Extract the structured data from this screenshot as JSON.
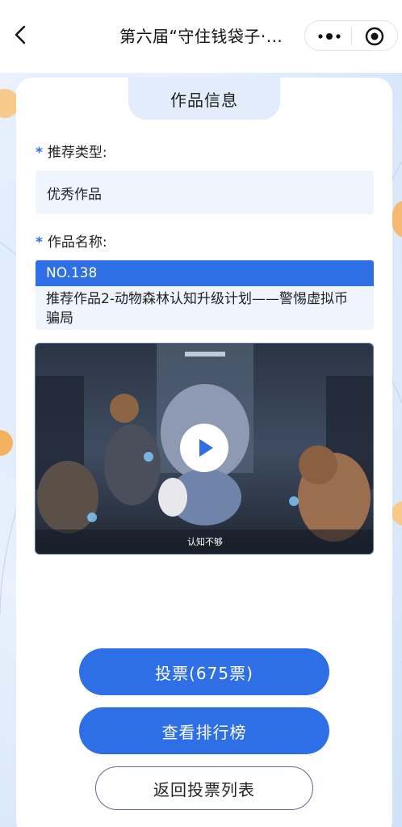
{
  "nav": {
    "title": "第六届“守住钱袋子·...",
    "more_icon": "more-dots-icon",
    "close_icon": "target-circle-icon"
  },
  "card": {
    "header": "作品信息",
    "type_label": "推荐类型:",
    "type_value": "优秀作品",
    "name_label": "作品名称:",
    "name_selected": "NO.138",
    "name_value": "推荐作品2-动物森林认知升级计划——警惕虚拟币骗局",
    "required_mark": "*"
  },
  "video": {
    "caption": "认知不够"
  },
  "buttons": {
    "vote": "投票(675票)",
    "ranking": "查看排行榜",
    "back_list": "返回投票列表"
  },
  "colors": {
    "accent": "#2f6fe6",
    "field_bg": "#eef5fd",
    "header_bg": "#e2ecfa"
  }
}
